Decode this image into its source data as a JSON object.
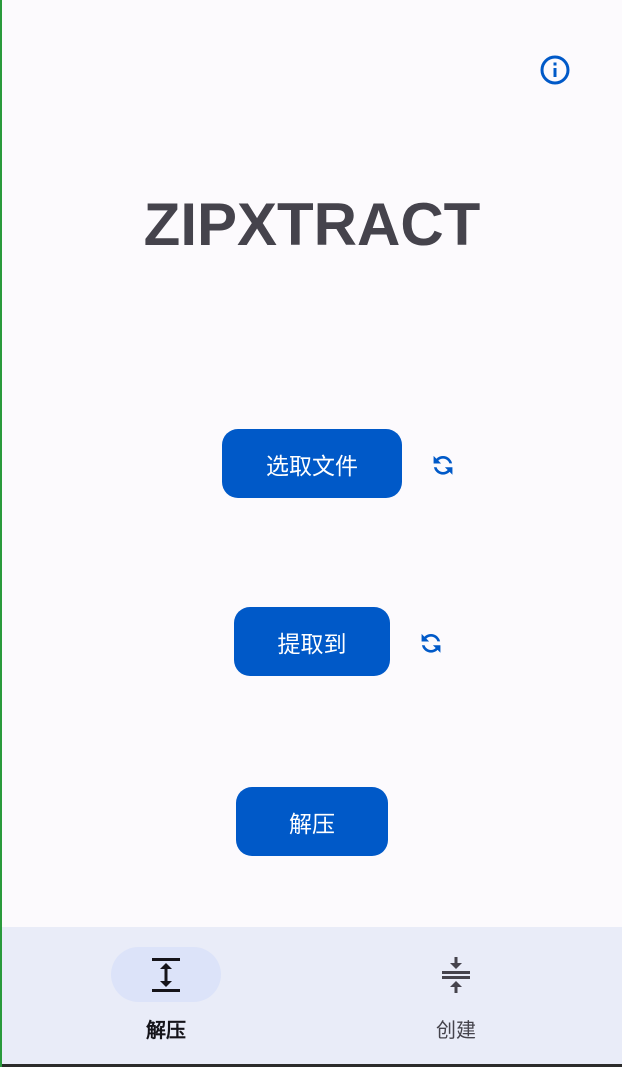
{
  "app": {
    "title": "ZIPXTRACT"
  },
  "header": {
    "info_icon": "info-circle-icon"
  },
  "actions": {
    "select_file_label": "选取文件",
    "extract_to_label": "提取到",
    "extract_label": "解压",
    "refresh_icon": "sync-icon"
  },
  "bottom_nav": {
    "items": [
      {
        "label": "解压",
        "icon": "expand-vertical-icon",
        "active": true
      },
      {
        "label": "创建",
        "icon": "compress-vertical-icon",
        "active": false
      }
    ]
  },
  "colors": {
    "primary": "#0059c8",
    "title_text": "#45434c",
    "background": "#fcfafd",
    "nav_background": "#e9ecf8",
    "nav_active_pill": "#dce3f9"
  }
}
